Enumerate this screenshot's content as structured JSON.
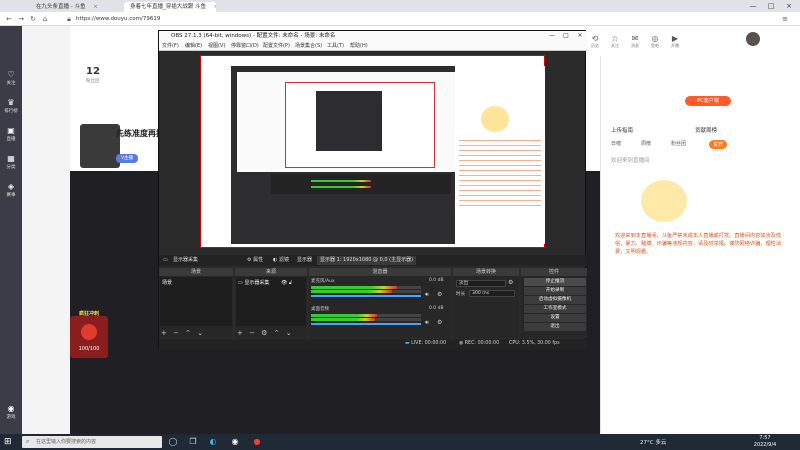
{
  "browser": {
    "tabs": [
      {
        "label": "在九头条直播 - 斗鱼",
        "close": "×"
      },
      {
        "label": "身着七年直播_穿插大战跟 斗鱼",
        "close": "×"
      }
    ],
    "url": "https://www.douyu.com/79619",
    "window_controls": [
      "—",
      "□",
      "×"
    ]
  },
  "rail": {
    "items": [
      "关注",
      "排行榜",
      "直播",
      "分类",
      "赛事",
      "游戏"
    ]
  },
  "header": {
    "logo": "斗鱼",
    "icons": [
      {
        "name": "history",
        "label": "历史",
        "glyph": "⟲"
      },
      {
        "name": "follow",
        "label": "关注",
        "glyph": "☆"
      },
      {
        "name": "message",
        "label": "消息",
        "glyph": "✉"
      },
      {
        "name": "fishbar",
        "label": "鱼吧",
        "glyph": "◎"
      },
      {
        "name": "live",
        "label": "开播",
        "glyph": "▶"
      }
    ]
  },
  "room": {
    "count_num": "12",
    "count_label": "粉丝团",
    "streamer_name": "先练准度再抽",
    "badge": "V主播",
    "gift_title": "疯狂冲刺",
    "gift_count": "100/100"
  },
  "right_panel": {
    "pc_button": "PC客户端",
    "upload_line": "上传指南",
    "rank_line": "贡献周榜",
    "tabs": [
      "日榜",
      "周榜",
      "粉丝团",
      "贵宾"
    ],
    "notice": "欢迎来到本直播间，斗鱼严禁未成年人直播或打赏。直播间内容如涉及低俗、暴力、赌博、诈骗等违规内容，请及时举报。谨防网络诈骗，理性消费，文明观看。",
    "welcome": "欢迎来到直播间"
  },
  "obs": {
    "title": "OBS 27.1.3 (64-bit, windows) - 配置文件: 未命名 - 场景: 未命名",
    "menu": [
      "文件(F)",
      "编辑(E)",
      "视图(V)",
      "停靠窗口(D)",
      "配置文件(P)",
      "场景集合(S)",
      "工具(T)",
      "帮助(H)"
    ],
    "source_bar": {
      "source": "显示器采集",
      "props": "属性",
      "filters": "滤镜",
      "display": "显示器",
      "display_value": "显示器 1: 1920x1080 @ 0,0 (主显示器)"
    },
    "docks": {
      "scenes": {
        "title": "场景",
        "items": [
          "场景"
        ]
      },
      "sources": {
        "title": "来源",
        "items": [
          "显示器采集"
        ]
      },
      "mixer": {
        "title": "混音器",
        "channels": [
          {
            "name": "麦克风/Aux",
            "db": "0.0 dB"
          },
          {
            "name": "桌面音频",
            "db": "0.0 dB"
          }
        ]
      },
      "transitions": {
        "title": "场景转换",
        "mode": "淡出",
        "duration_label": "时长",
        "duration": "300 ms"
      },
      "controls": {
        "title": "控件",
        "buttons": [
          "停止推流",
          "开始录制",
          "启动虚拟摄像机",
          "工作室模式",
          "设置",
          "退出"
        ]
      }
    },
    "status": {
      "live": "LIVE: 00:00:00",
      "rec": "REC: 00:00:00",
      "cpu": "CPU: 3.5%, 30.00 fps"
    }
  },
  "taskbar": {
    "search_placeholder": "在这里输入你要搜索的内容",
    "weather": "27°C 多云",
    "time": "7:57",
    "date": "2022/9/4"
  }
}
